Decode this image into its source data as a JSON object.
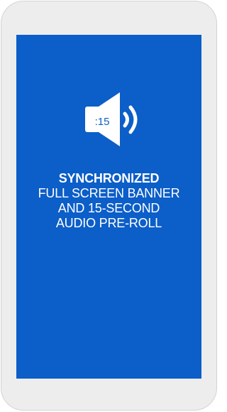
{
  "ad": {
    "duration_badge": ":15",
    "headline": "SYNCHRONIZED",
    "lines": [
      "FULL SCREEN BANNER",
      "AND 15-SECOND",
      "AUDIO PRE-ROLL"
    ]
  },
  "colors": {
    "screen": "#0c5ec8",
    "phone_body": "#ededed",
    "text": "#ffffff"
  },
  "icons": {
    "speaker": "speaker-volume-icon"
  }
}
